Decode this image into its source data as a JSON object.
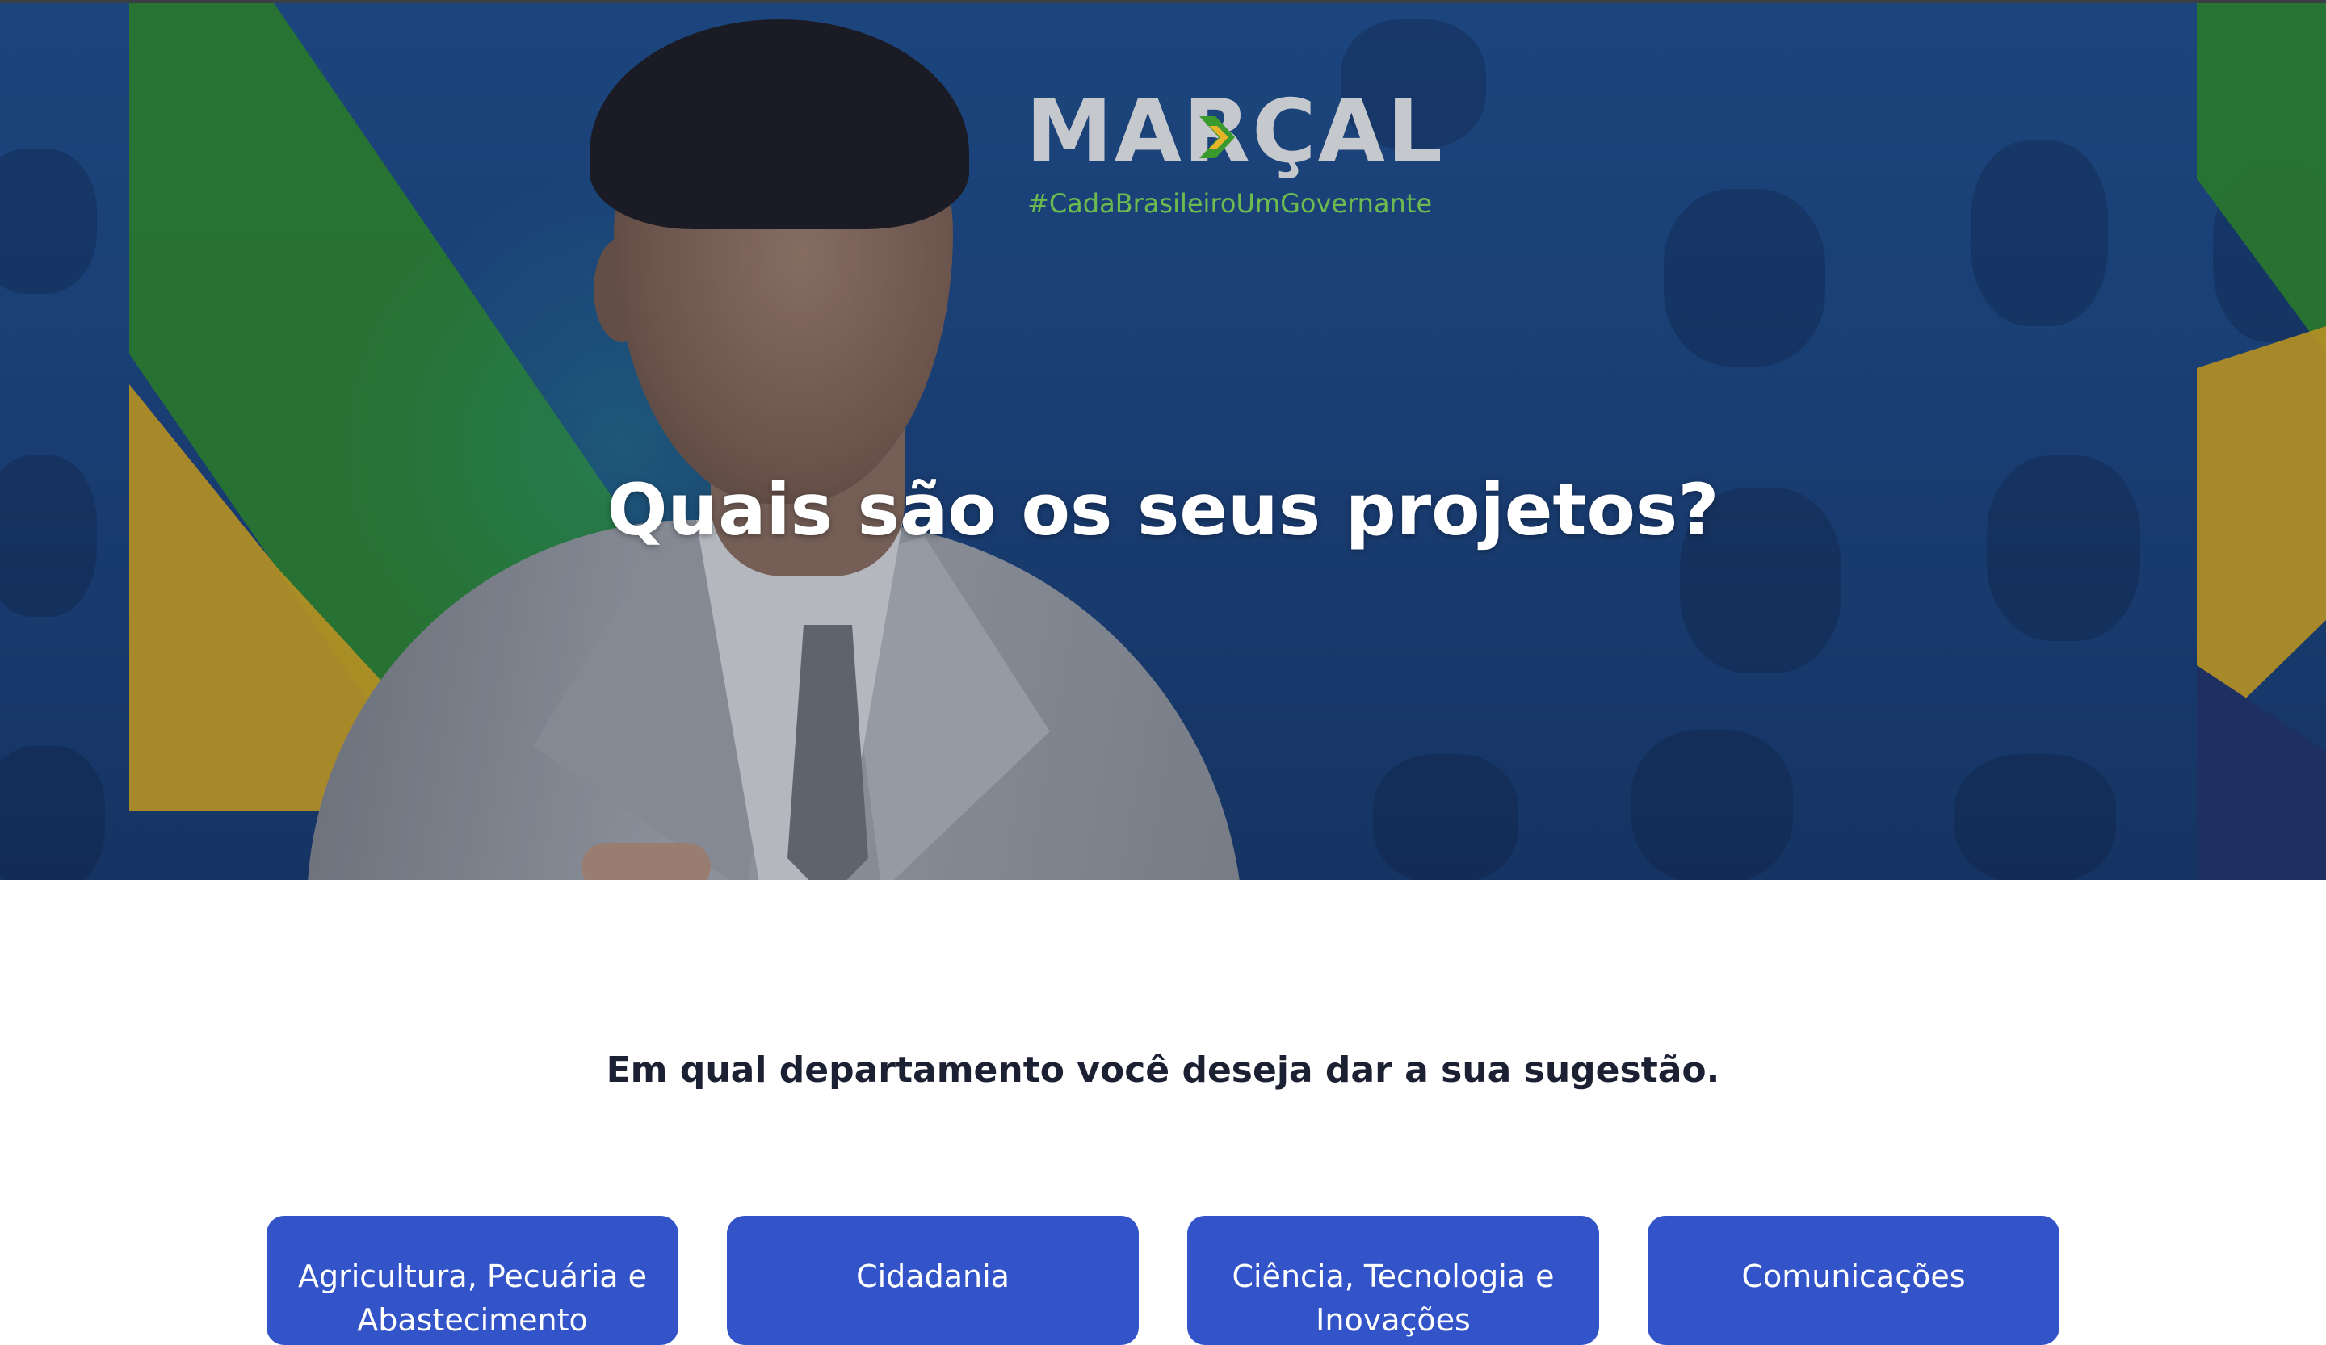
{
  "hero": {
    "logo_text": "MARÇAL",
    "tagline": "#CadaBrasileiroUmGovernante",
    "title": "Quais são os seus projetos?",
    "colors": {
      "background": "#1c4680",
      "green": "#3a9a2e",
      "yellow": "#e8b52a",
      "title": "#ffffff"
    }
  },
  "prompt": "Em qual departamento você deseja dar a sua sugestão.",
  "departments": [
    {
      "label": "Agricultura, Pecuária e Abastecimento"
    },
    {
      "label": "Cidadania"
    },
    {
      "label": "Ciência, Tecnologia e Inovações"
    },
    {
      "label": "Comunicações"
    }
  ],
  "colors": {
    "button": "#3354c8",
    "prompt_text": "#1c2033",
    "page_bg": "#ffffff"
  }
}
